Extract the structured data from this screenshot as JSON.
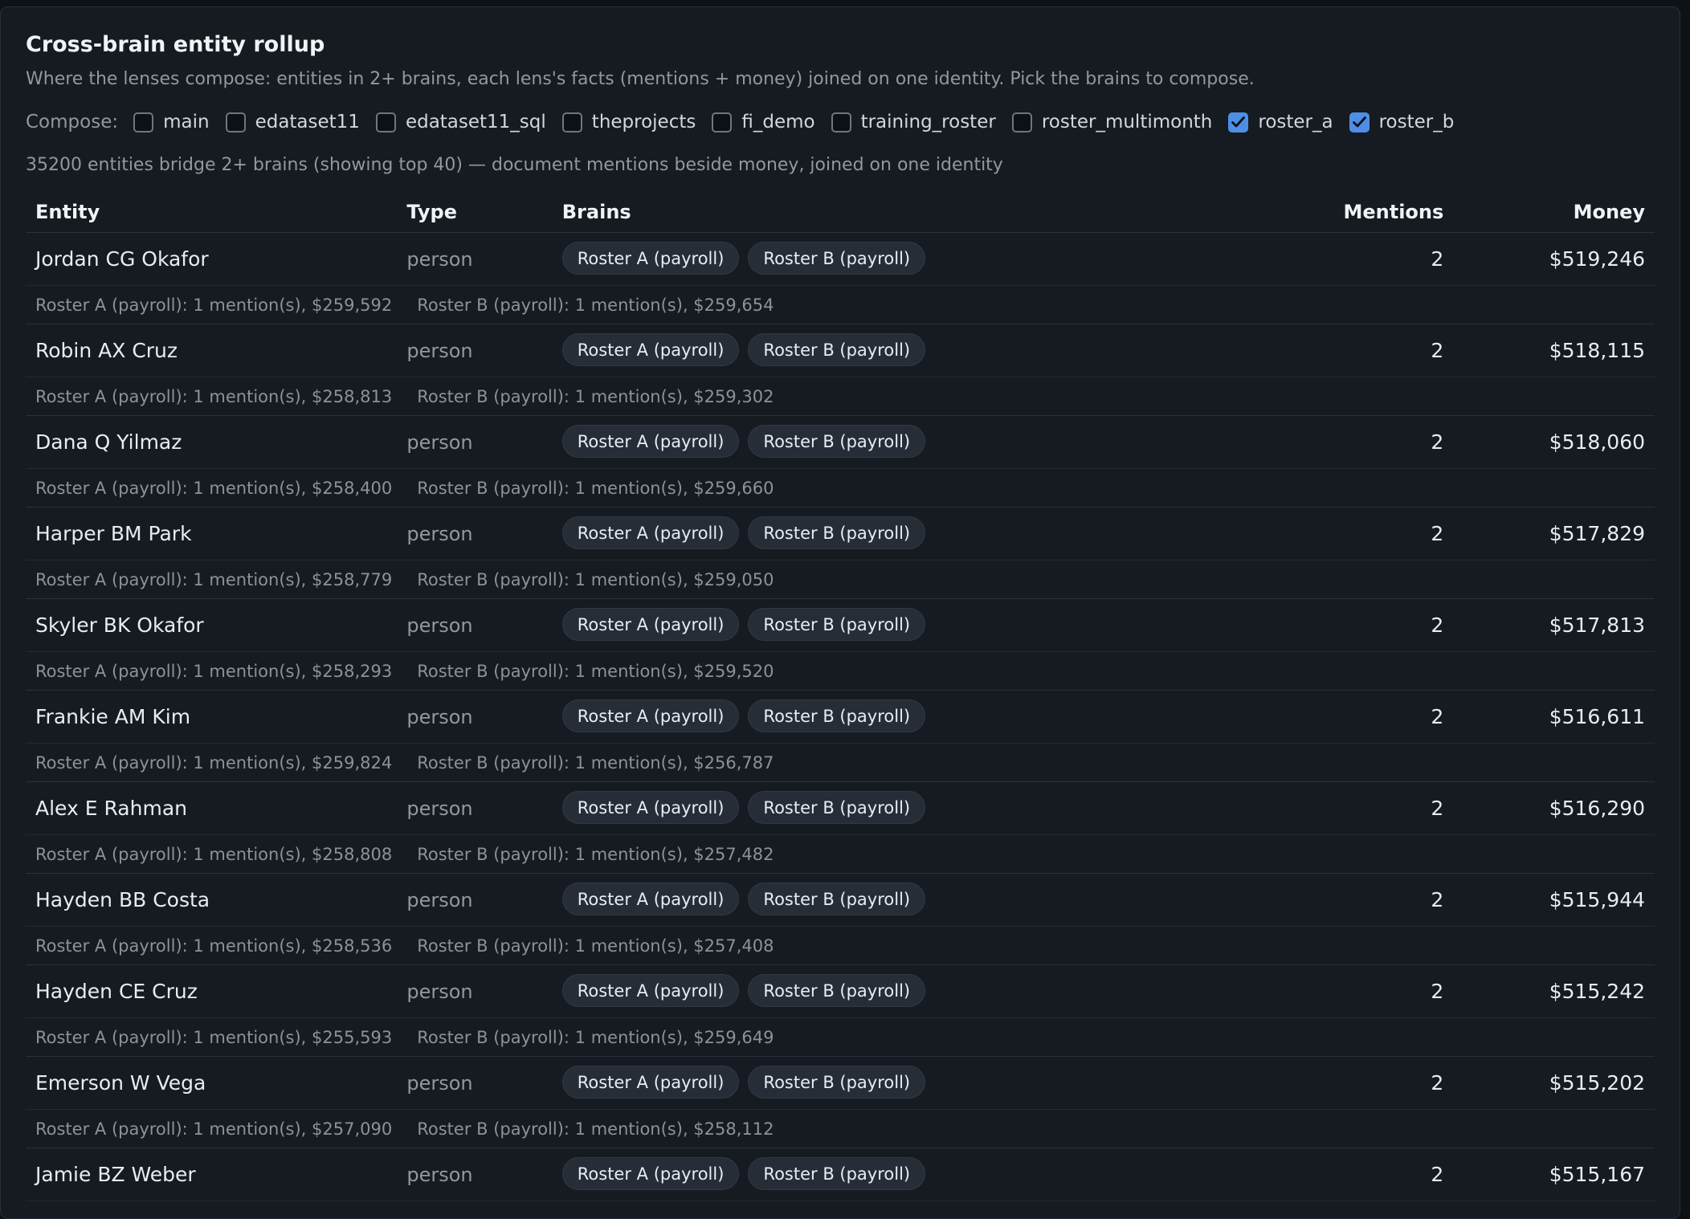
{
  "header": {
    "title": "Cross-brain entity rollup",
    "subtitle": "Where the lenses compose: entities in 2+ brains, each lens's facts (mentions + money) joined on one identity. Pick the brains to compose."
  },
  "compose": {
    "label": "Compose:",
    "options": [
      {
        "label": "main",
        "checked": false
      },
      {
        "label": "edataset11",
        "checked": false
      },
      {
        "label": "edataset11_sql",
        "checked": false
      },
      {
        "label": "theprojects",
        "checked": false
      },
      {
        "label": "fi_demo",
        "checked": false
      },
      {
        "label": "training_roster",
        "checked": false
      },
      {
        "label": "roster_multimonth",
        "checked": false
      },
      {
        "label": "roster_a",
        "checked": true
      },
      {
        "label": "roster_b",
        "checked": true
      }
    ]
  },
  "summary": "35200 entities bridge 2+ brains (showing top 40) — document mentions beside money, joined on one identity",
  "table": {
    "columns": {
      "entity": "Entity",
      "type": "Type",
      "brains": "Brains",
      "mentions": "Mentions",
      "money": "Money"
    },
    "rows": [
      {
        "entity": "Jordan CG Okafor",
        "type": "person",
        "brains": [
          "Roster A (payroll)",
          "Roster B (payroll)"
        ],
        "mentions": "2",
        "money": "$519,246",
        "detail_a": "Roster A (payroll): 1 mention(s), $259,592",
        "detail_b": "Roster B (payroll): 1 mention(s), $259,654"
      },
      {
        "entity": "Robin AX Cruz",
        "type": "person",
        "brains": [
          "Roster A (payroll)",
          "Roster B (payroll)"
        ],
        "mentions": "2",
        "money": "$518,115",
        "detail_a": "Roster A (payroll): 1 mention(s), $258,813",
        "detail_b": "Roster B (payroll): 1 mention(s), $259,302"
      },
      {
        "entity": "Dana Q Yilmaz",
        "type": "person",
        "brains": [
          "Roster A (payroll)",
          "Roster B (payroll)"
        ],
        "mentions": "2",
        "money": "$518,060",
        "detail_a": "Roster A (payroll): 1 mention(s), $258,400",
        "detail_b": "Roster B (payroll): 1 mention(s), $259,660"
      },
      {
        "entity": "Harper BM Park",
        "type": "person",
        "brains": [
          "Roster A (payroll)",
          "Roster B (payroll)"
        ],
        "mentions": "2",
        "money": "$517,829",
        "detail_a": "Roster A (payroll): 1 mention(s), $258,779",
        "detail_b": "Roster B (payroll): 1 mention(s), $259,050"
      },
      {
        "entity": "Skyler BK Okafor",
        "type": "person",
        "brains": [
          "Roster A (payroll)",
          "Roster B (payroll)"
        ],
        "mentions": "2",
        "money": "$517,813",
        "detail_a": "Roster A (payroll): 1 mention(s), $258,293",
        "detail_b": "Roster B (payroll): 1 mention(s), $259,520"
      },
      {
        "entity": "Frankie AM Kim",
        "type": "person",
        "brains": [
          "Roster A (payroll)",
          "Roster B (payroll)"
        ],
        "mentions": "2",
        "money": "$516,611",
        "detail_a": "Roster A (payroll): 1 mention(s), $259,824",
        "detail_b": "Roster B (payroll): 1 mention(s), $256,787"
      },
      {
        "entity": "Alex E Rahman",
        "type": "person",
        "brains": [
          "Roster A (payroll)",
          "Roster B (payroll)"
        ],
        "mentions": "2",
        "money": "$516,290",
        "detail_a": "Roster A (payroll): 1 mention(s), $258,808",
        "detail_b": "Roster B (payroll): 1 mention(s), $257,482"
      },
      {
        "entity": "Hayden BB Costa",
        "type": "person",
        "brains": [
          "Roster A (payroll)",
          "Roster B (payroll)"
        ],
        "mentions": "2",
        "money": "$515,944",
        "detail_a": "Roster A (payroll): 1 mention(s), $258,536",
        "detail_b": "Roster B (payroll): 1 mention(s), $257,408"
      },
      {
        "entity": "Hayden CE Cruz",
        "type": "person",
        "brains": [
          "Roster A (payroll)",
          "Roster B (payroll)"
        ],
        "mentions": "2",
        "money": "$515,242",
        "detail_a": "Roster A (payroll): 1 mention(s), $255,593",
        "detail_b": "Roster B (payroll): 1 mention(s), $259,649"
      },
      {
        "entity": "Emerson W Vega",
        "type": "person",
        "brains": [
          "Roster A (payroll)",
          "Roster B (payroll)"
        ],
        "mentions": "2",
        "money": "$515,202",
        "detail_a": "Roster A (payroll): 1 mention(s), $257,090",
        "detail_b": "Roster B (payroll): 1 mention(s), $258,112"
      },
      {
        "entity": "Jamie BZ Weber",
        "type": "person",
        "brains": [
          "Roster A (payroll)",
          "Roster B (payroll)"
        ],
        "mentions": "2",
        "money": "$515,167"
      }
    ]
  },
  "colors": {
    "accent": "#4d8fe6",
    "background": "#161a21"
  }
}
